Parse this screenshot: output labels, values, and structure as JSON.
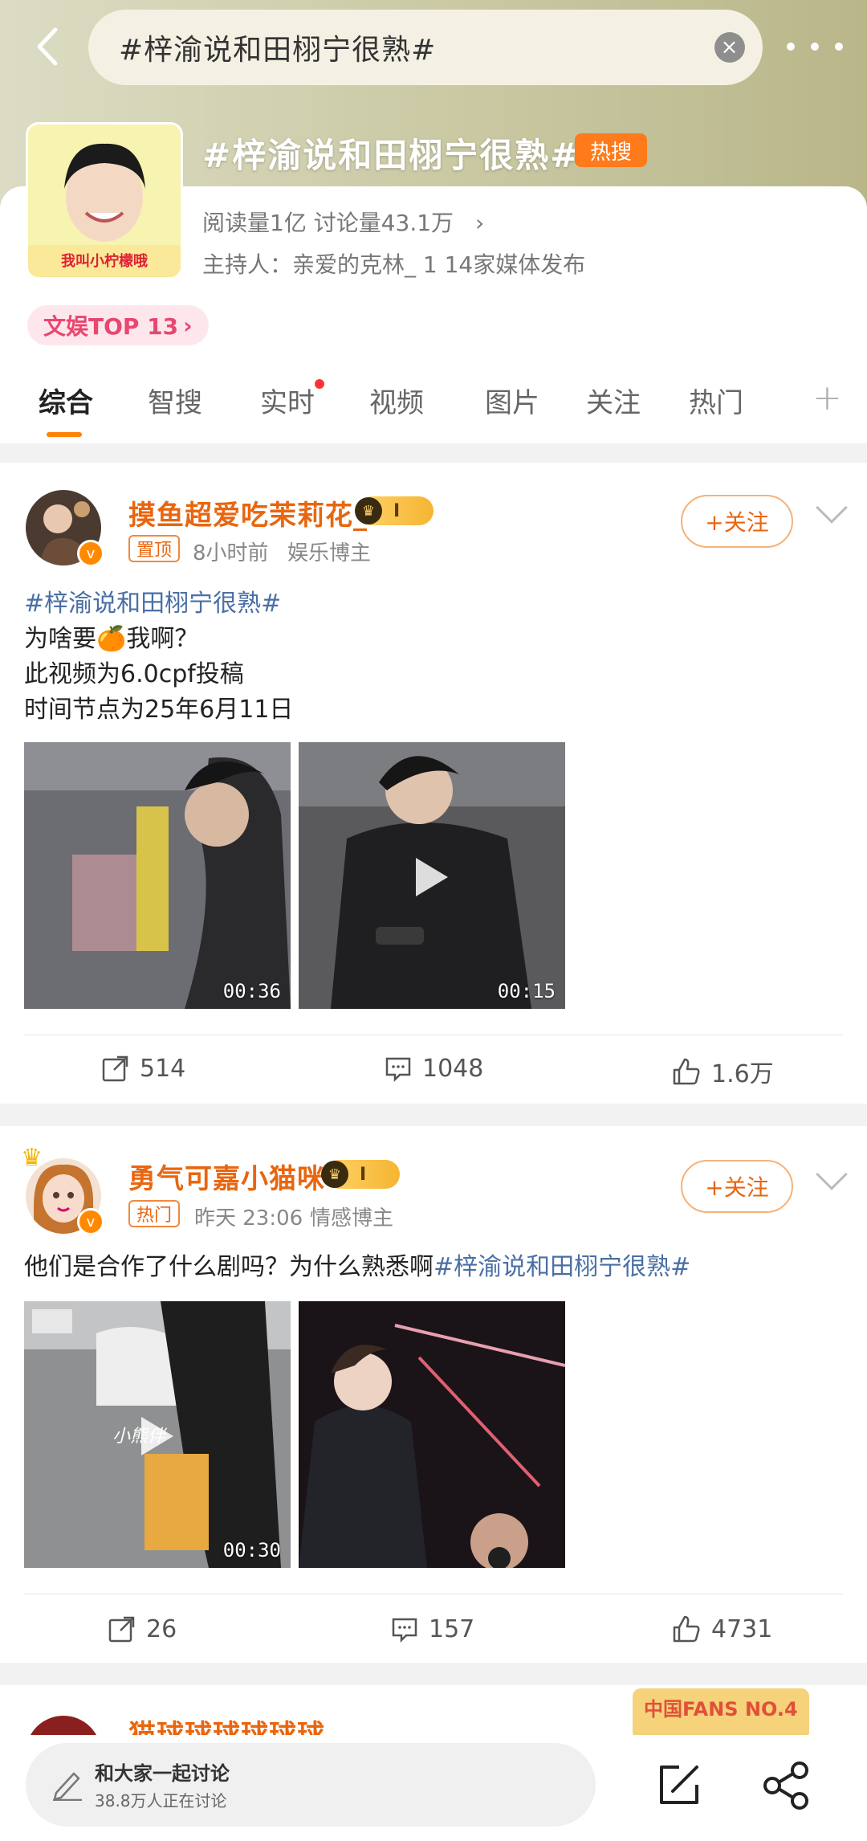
{
  "header": {
    "search_text": "#梓渝说和田栩宁很熟#",
    "clear_glyph": "×"
  },
  "topic": {
    "title": "#梓渝说和田栩宁很熟#",
    "hot_badge": "热搜",
    "stats": "阅读量1亿  讨论量43.1万",
    "host": "主持人：亲爱的克林_  1 14家媒体发布",
    "avatar_caption": "我叫小柠檬哦",
    "rank": "文娱TOP 13"
  },
  "tabs": [
    "综合",
    "智搜",
    "实时",
    "视频",
    "图片",
    "关注",
    "热门"
  ],
  "posts": [
    {
      "user": "摸鱼超爱吃茉莉花_",
      "vip_level": "I",
      "tag": "置顶",
      "time": "8小时前",
      "role": "娱乐博主",
      "follow": "+关注",
      "hashtag": "#梓渝说和田栩宁很熟#",
      "lines": [
        "为啥要🍊我啊？",
        "此视频为6.0cpf投稿",
        "时间节点为25年6月11日"
      ],
      "durations": [
        "00:36",
        "00:15"
      ],
      "reposts": "514",
      "comments": "1048",
      "likes": "1.6万"
    },
    {
      "user": "勇气可嘉小猫咪",
      "vip_level": "I",
      "tag": "热门",
      "time": "昨天 23:06",
      "role": "情感博主",
      "follow": "+关注",
      "text": "他们是合作了什么剧吗？为什么熟悉啊",
      "hashtag": "#梓渝说和田栩宁很熟#",
      "durations": [
        "00:30",
        ""
      ],
      "watermark": "小熊伴",
      "reposts": "26",
      "comments": "157",
      "likes": "4731"
    }
  ],
  "third_post_user": "猫球球球球球球",
  "third_post_badge": "中国FANS NO.4",
  "bottom": {
    "compose_title": "和大家一起讨论",
    "compose_sub": "38.8万人正在讨论"
  },
  "colors": {
    "accent": "#ff8200",
    "username": "#e8660f",
    "hashtag": "#4a6fa5"
  }
}
